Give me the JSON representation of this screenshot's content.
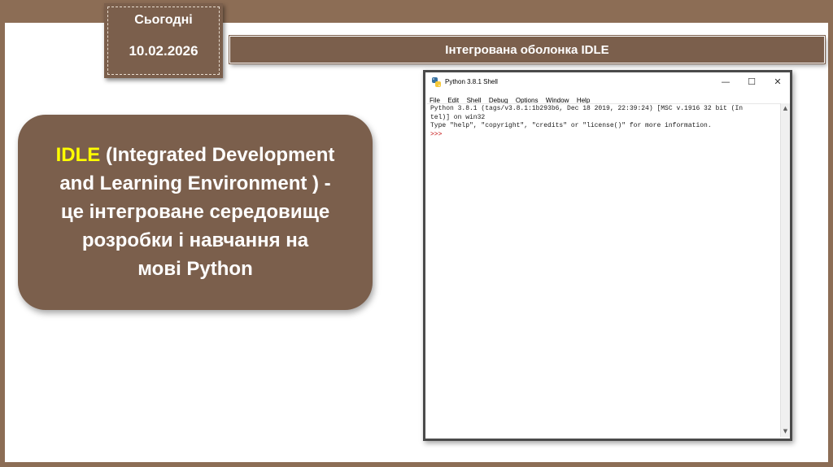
{
  "date_badge": {
    "label": "Сьогодні",
    "date": "10.02.2026"
  },
  "title": "Інтегрована оболонка IDLE",
  "definition": {
    "term": "IDLE",
    "text_line1": "  (Integrated Development",
    "text_line2": "and Learning Environment ) -",
    "text_line3": "це інтегроване середовище",
    "text_line4": "розробки і навчання на",
    "text_line5": "мові Python",
    "term_color": "#ffff00"
  },
  "idle_window": {
    "title": "Python 3.8.1 Shell",
    "controls": {
      "minimize": "—",
      "maximize": "☐",
      "close": "✕"
    },
    "menu": [
      "File",
      "Edit",
      "Shell",
      "Debug",
      "Options",
      "Window",
      "Help"
    ],
    "lines": [
      "Python 3.8.1 (tags/v3.8.1:1b293b6, Dec 18 2019, 22:39:24) [MSC v.1916 32 bit (In",
      "tel)] on win32",
      "Type \"help\", \"copyright\", \"credits\" or \"license()\" for more information."
    ],
    "prompt": ">>>",
    "scroll_up": "▲",
    "scroll_down": "▼",
    "icon": "python-icon"
  },
  "colors": {
    "frame": "#8c6d55",
    "brown": "#7b5f4c",
    "prompt": "#c00000"
  }
}
